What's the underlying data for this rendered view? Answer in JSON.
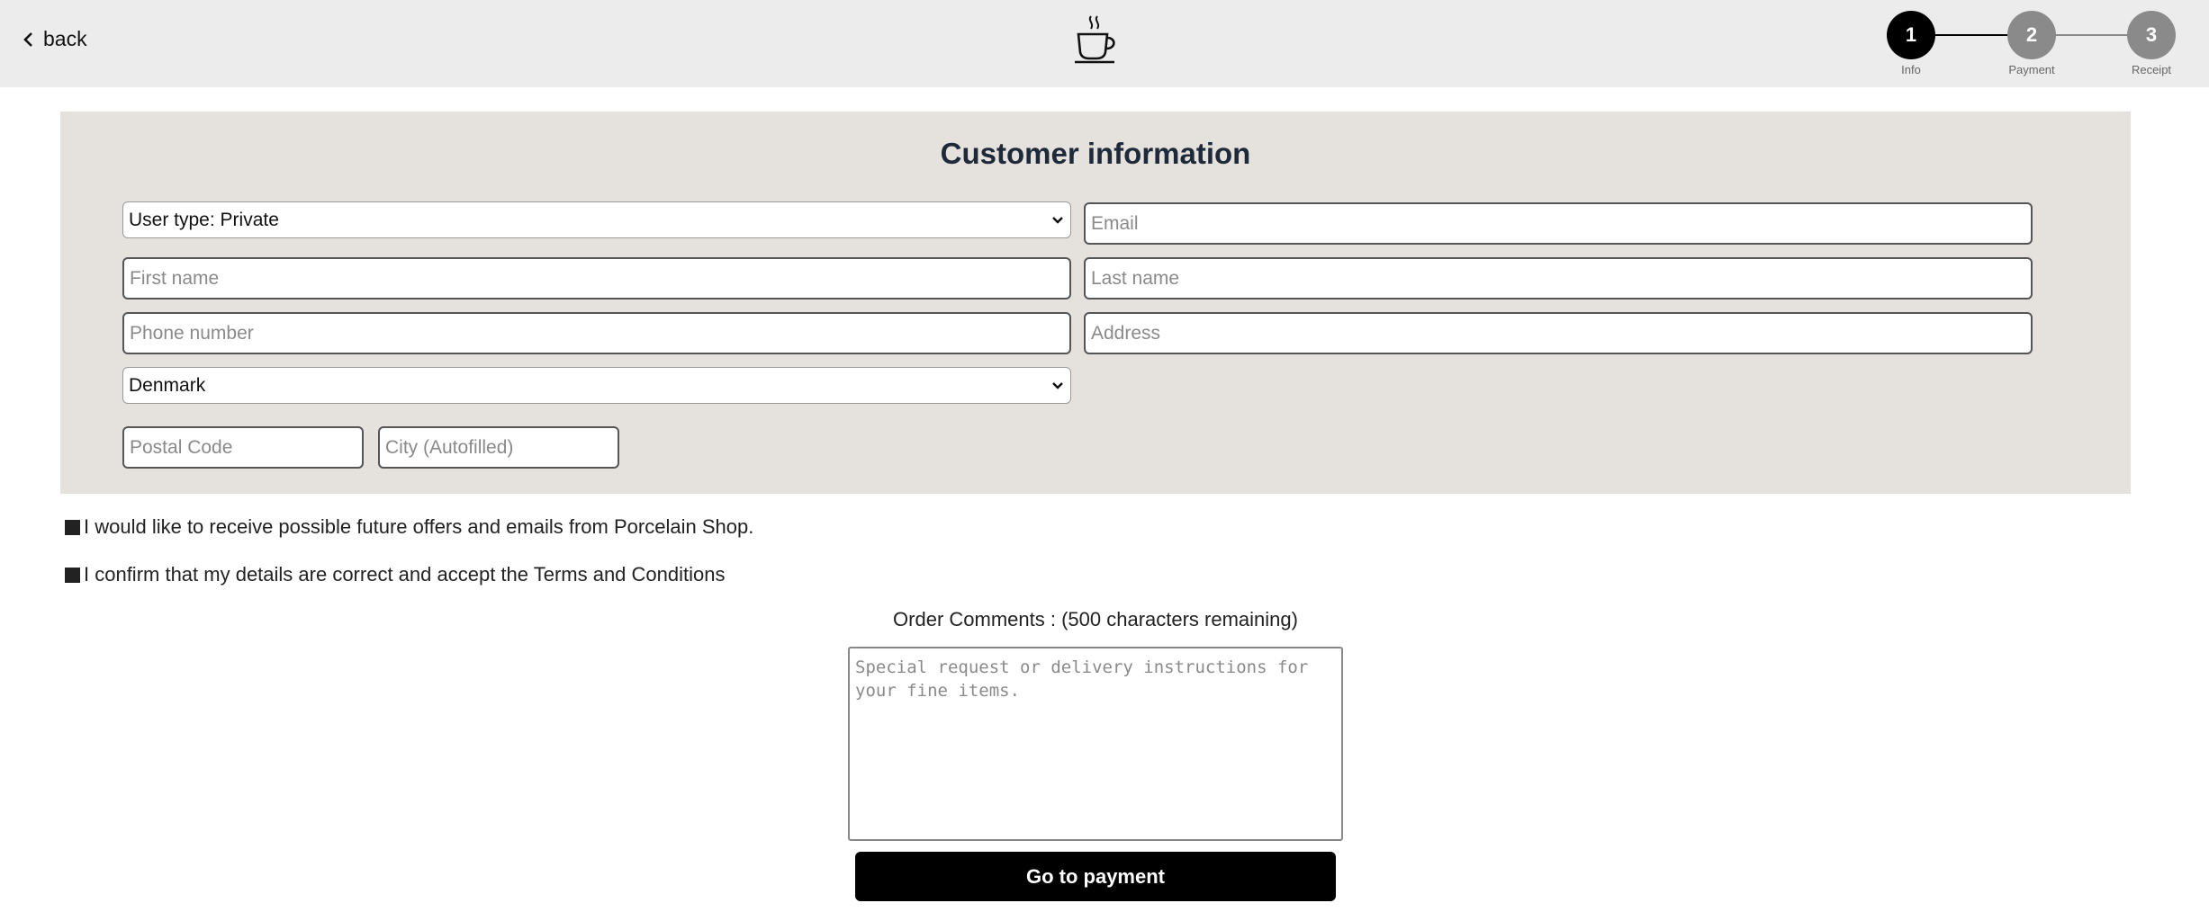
{
  "header": {
    "back_label": "back",
    "logo_icon": "coffee-cup-icon"
  },
  "stepper": {
    "active_color": "#000000",
    "inactive_color": "#8a8a8a",
    "steps": [
      {
        "number": "1",
        "label": "Info",
        "active": true
      },
      {
        "number": "2",
        "label": "Payment",
        "active": false
      },
      {
        "number": "3",
        "label": "Receipt",
        "active": false
      }
    ]
  },
  "form": {
    "title": "Customer information",
    "user_type": {
      "value": "User type: Private"
    },
    "email": {
      "placeholder": "Email",
      "value": ""
    },
    "first_name": {
      "placeholder": "First name",
      "value": ""
    },
    "last_name": {
      "placeholder": "Last name",
      "value": ""
    },
    "phone": {
      "placeholder": "Phone number",
      "value": ""
    },
    "address": {
      "placeholder": "Address",
      "value": ""
    },
    "country": {
      "value": "Denmark"
    },
    "postal_code": {
      "placeholder": "Postal Code",
      "value": ""
    },
    "city": {
      "placeholder": "City (Autofilled)",
      "value": ""
    }
  },
  "consents": {
    "offers_label": "I would like to receive possible future offers and emails from Porcelain Shop.",
    "terms_label": "I confirm that my details are correct and accept the Terms and Conditions"
  },
  "comments": {
    "label": "Order Comments : (500 characters remaining)",
    "placeholder": "Special request or delivery instructions for your fine items."
  },
  "actions": {
    "go_to_payment_label": "Go to payment"
  },
  "colors": {
    "header_bg": "#ececec",
    "panel_bg": "#e5e1dc",
    "title_color": "#1e2a3a",
    "button_bg": "#000000"
  }
}
